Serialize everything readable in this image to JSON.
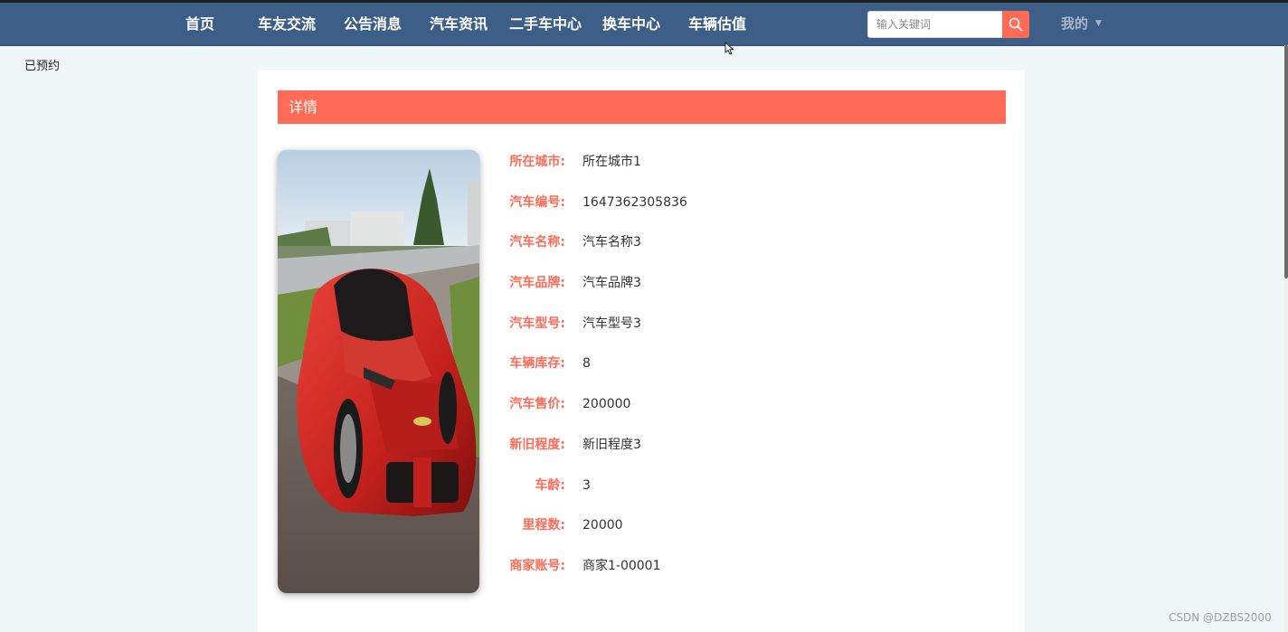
{
  "nav": {
    "items": [
      {
        "label": "首页"
      },
      {
        "label": "车友交流"
      },
      {
        "label": "公告消息"
      },
      {
        "label": "汽车资讯"
      },
      {
        "label": "二手车中心"
      },
      {
        "label": "换车中心"
      },
      {
        "label": "车辆估值"
      }
    ],
    "search": {
      "placeholder": "输入关键词",
      "icon": "search-icon"
    },
    "user_menu": {
      "label": "我的",
      "icon": "caret-down-icon"
    }
  },
  "corner_text": "已预约",
  "detail": {
    "header": "详情",
    "image": {
      "subject": "red sports car on track"
    },
    "fields": [
      {
        "label": "所在城市:",
        "value": "所在城市1"
      },
      {
        "label": "汽车编号:",
        "value": "1647362305836"
      },
      {
        "label": "汽车名称:",
        "value": "汽车名称3"
      },
      {
        "label": "汽车品牌:",
        "value": "汽车品牌3"
      },
      {
        "label": "汽车型号:",
        "value": "汽车型号3"
      },
      {
        "label": "车辆库存:",
        "value": "8"
      },
      {
        "label": "汽车售价:",
        "value": "200000"
      },
      {
        "label": "新旧程度:",
        "value": "新旧程度3"
      },
      {
        "label": "车龄:",
        "value": "3"
      },
      {
        "label": "里程数:",
        "value": "20000"
      },
      {
        "label": "商家账号:",
        "value": "商家1-00001"
      }
    ]
  },
  "watermark": "CSDN @DZBS2000",
  "colors": {
    "nav_bg": "#3d5f87",
    "accent": "#ff6b56",
    "page_bg": "#f0f7f9"
  }
}
